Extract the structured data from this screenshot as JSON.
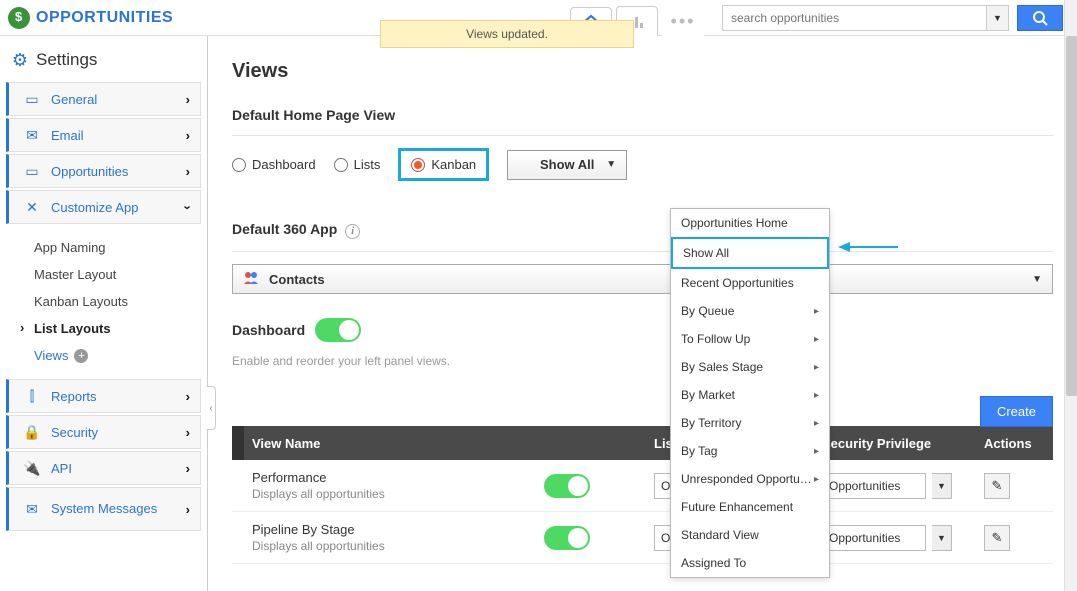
{
  "brand": {
    "title": "OPPORTUNITIES"
  },
  "search": {
    "placeholder": "search opportunities"
  },
  "notice": "Views updated.",
  "sidebar": {
    "title": "Settings",
    "items": [
      {
        "icon": "▭",
        "label": "General"
      },
      {
        "icon": "✉",
        "label": "Email"
      },
      {
        "icon": "▭",
        "label": "Opportunities"
      },
      {
        "icon": "✕",
        "label": "Customize App"
      }
    ],
    "subs": {
      "app_naming": "App Naming",
      "master_layout": "Master Layout",
      "kanban_layouts": "Kanban Layouts",
      "list_layouts": "List Layouts",
      "views": "Views"
    },
    "after": [
      {
        "icon": "⫿",
        "label": "Reports"
      },
      {
        "icon": "🔒",
        "label": "Security"
      },
      {
        "icon": "🔌",
        "label": "API"
      },
      {
        "icon": "✉",
        "label": "System Messages"
      }
    ]
  },
  "main": {
    "title": "Views",
    "default_view_heading": "Default Home Page View",
    "radios": {
      "dashboard": "Dashboard",
      "lists": "Lists",
      "kanban": "Kanban"
    },
    "showall_dropdown": "Show All",
    "default_360_heading": "Default 360 App",
    "contacts_combo": "Contacts",
    "dashboard_heading": "Dashboard",
    "dashboard_hint": "Enable and reorder your left panel views.",
    "create_btn": "Create",
    "cols": {
      "name": "View Name",
      "layout": "List Layout",
      "sec": "Security Privilege",
      "act": "Actions"
    },
    "rows": [
      {
        "name": "Performance",
        "desc": "Displays all opportunities",
        "layout": "Overview",
        "sec": "Opportunities"
      },
      {
        "name": "Pipeline By Stage",
        "desc": "Displays all opportunities",
        "layout": "Overview",
        "sec": "Opportunities"
      }
    ]
  },
  "menu": {
    "items": [
      {
        "label": "Opportunities Home",
        "sub": false
      },
      {
        "label": "Show All",
        "sub": false,
        "hl": true
      },
      {
        "label": "Recent Opportunities",
        "sub": false
      },
      {
        "label": "By Queue",
        "sub": true
      },
      {
        "label": "To Follow Up",
        "sub": true
      },
      {
        "label": "By Sales Stage",
        "sub": true
      },
      {
        "label": "By Market",
        "sub": true
      },
      {
        "label": "By Territory",
        "sub": true
      },
      {
        "label": "By Tag",
        "sub": true
      },
      {
        "label": "Unresponded Opportu…",
        "sub": true
      },
      {
        "label": "Future Enhancement",
        "sub": false
      },
      {
        "label": "Standard View",
        "sub": false
      },
      {
        "label": "Assigned To",
        "sub": false
      }
    ]
  }
}
